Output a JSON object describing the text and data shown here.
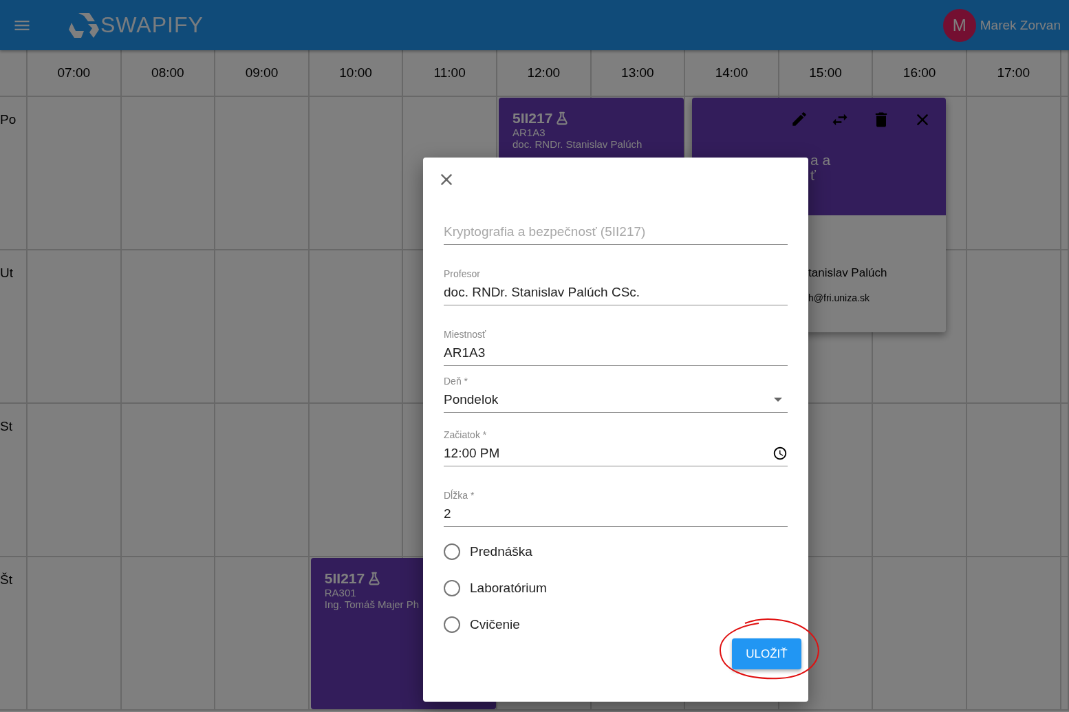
{
  "app_bar": {
    "title": "SWAPIFY",
    "user": {
      "initial": "M",
      "name": "Marek Zorvan"
    }
  },
  "timetable": {
    "hours": [
      "07:00",
      "08:00",
      "09:00",
      "10:00",
      "11:00",
      "12:00",
      "13:00",
      "14:00",
      "15:00",
      "16:00",
      "17:00"
    ],
    "days": [
      "Po",
      "Ut",
      "St",
      "Št"
    ],
    "events": [
      {
        "code": "5II217",
        "room": "AR1A3",
        "teacher": "doc. RNDr. Stanislav Palúch"
      },
      {
        "code": "5II217",
        "room": "RA301",
        "teacher": "Ing. Tomáš Majer Ph"
      }
    ]
  },
  "detail_card": {
    "title_lines": [
      "a a",
      "ť"
    ],
    "teacher": "tanislav Palúch",
    "email": "h@fri.uniza.sk"
  },
  "dialog": {
    "fields": [
      {
        "kind": "text",
        "value": "Kryptografia a bezpečnosť (5II217)",
        "disabled": true
      },
      {
        "kind": "text",
        "label": "Profesor",
        "value": "doc. RNDr. Stanislav Palúch CSc.",
        "disabled": false
      },
      {
        "kind": "text",
        "label": "Miestnosť",
        "value": "AR1A3",
        "disabled": false
      },
      {
        "kind": "select",
        "label": "Deň *",
        "value": "Pondelok",
        "disabled": false
      },
      {
        "kind": "time",
        "label": "Začiatok *",
        "value": "12:00 PM",
        "disabled": false
      },
      {
        "kind": "text",
        "label": "Dĺžka *",
        "value": "2",
        "disabled": false
      }
    ],
    "options": [
      {
        "label": "Prednáška",
        "selected": false
      },
      {
        "label": "Laboratórium",
        "selected": false
      },
      {
        "label": "Cvičenie",
        "selected": false
      }
    ],
    "save_button": "ULOŽIŤ"
  }
}
